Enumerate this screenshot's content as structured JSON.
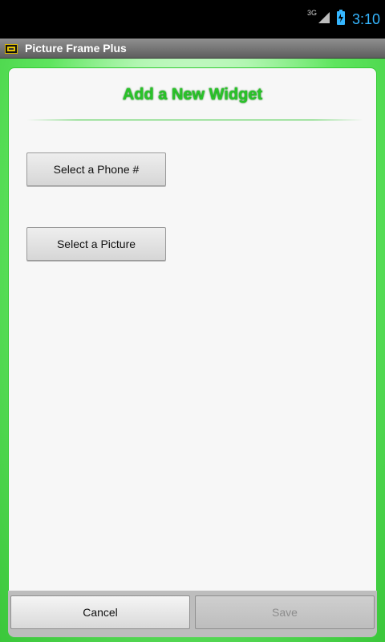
{
  "status_bar": {
    "network_type": "3G",
    "time": "3:10"
  },
  "title_bar": {
    "app_title": "Picture Frame Plus"
  },
  "dialog": {
    "title": "Add a New Widget",
    "buttons": {
      "select_phone": "Select a Phone #",
      "select_picture": "Select a Picture"
    }
  },
  "bottom_bar": {
    "cancel": "Cancel",
    "save": "Save"
  }
}
